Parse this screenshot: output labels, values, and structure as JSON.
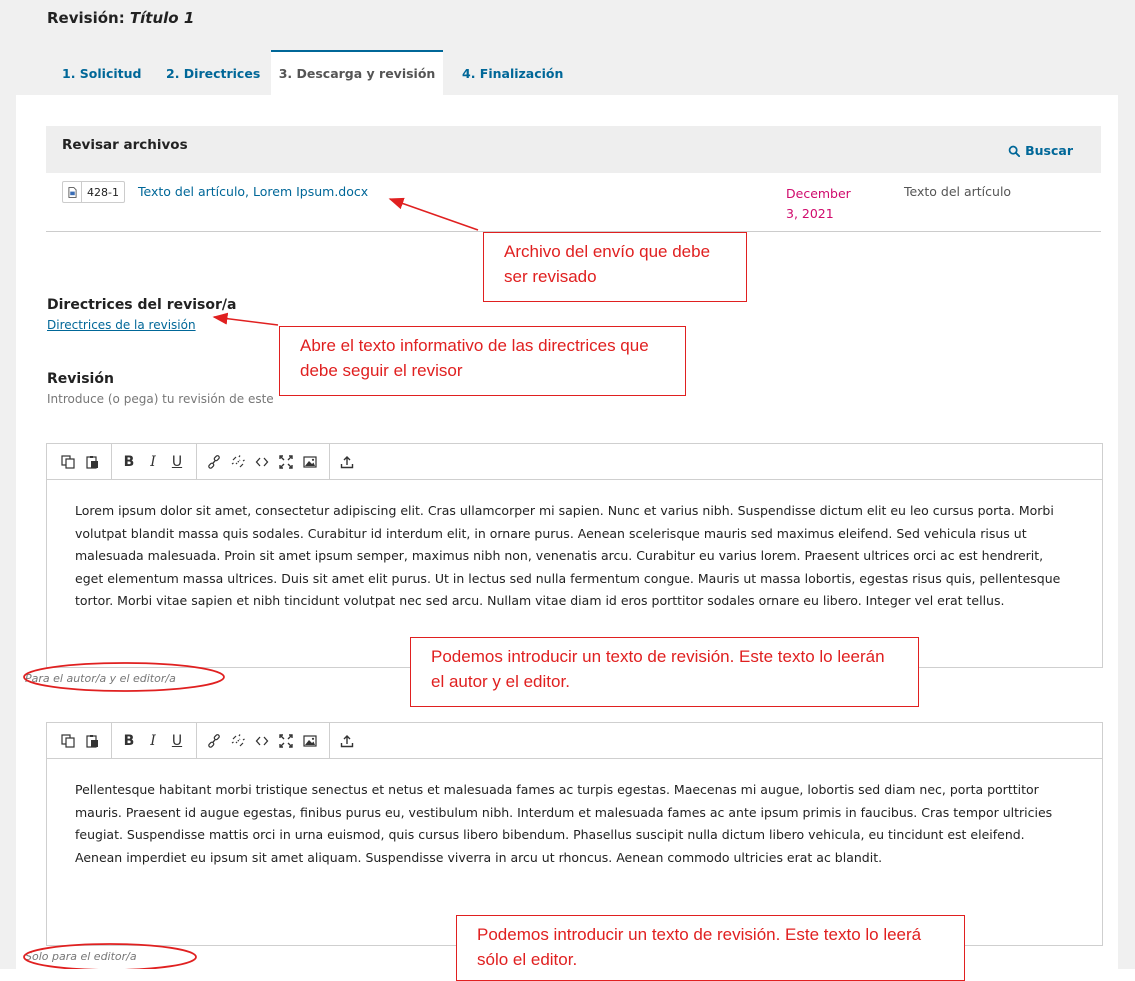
{
  "page": {
    "title_prefix": "Revisión: ",
    "title_name": "Título 1"
  },
  "tabs": [
    {
      "label": "1. Solicitud"
    },
    {
      "label": "2. Directrices"
    },
    {
      "label": "3. Descarga y revisión"
    },
    {
      "label": "4. Finalización"
    }
  ],
  "files": {
    "title": "Revisar archivos",
    "search_label": "Buscar",
    "row": {
      "id": "428-1",
      "name": "Texto del artículo, Lorem Ipsum.docx",
      "date": "December 3, 2021",
      "type": "Texto del artículo"
    }
  },
  "guidelines": {
    "heading": "Directrices del revisor/a",
    "link": "Directrices de la revisión"
  },
  "review": {
    "heading": "Revisión",
    "description": "Introduce (o pega) tu revisión de este"
  },
  "editor1": {
    "text": "Lorem ipsum dolor sit amet, consectetur adipiscing elit. Cras ullamcorper mi sapien. Nunc et varius nibh. Suspendisse dictum elit eu leo cursus porta. Morbi volutpat blandit massa quis sodales. Curabitur id interdum elit, in ornare purus. Aenean scelerisque mauris sed maximus eleifend. Sed vehicula risus ut malesuada malesuada. Proin sit amet ipsum semper, maximus nibh non, venenatis arcu. Curabitur eu varius lorem. Praesent ultrices orci ac est hendrerit, eget elementum massa ultrices. Duis sit amet elit purus. Ut in lectus sed nulla fermentum congue. Mauris ut massa lobortis, egestas risus quis, pellentesque tortor. Morbi vitae sapien et nibh tincidunt volutpat nec sed arcu. Nullam vitae diam id eros porttitor sodales ornare eu libero. Integer vel erat tellus.",
    "label": "Para el autor/a y el editor/a"
  },
  "editor2": {
    "text": "Pellentesque habitant morbi tristique senectus et netus et malesuada fames ac turpis egestas. Maecenas mi augue, lobortis sed diam nec, porta porttitor mauris. Praesent id augue egestas, finibus purus eu, vestibulum nibh. Interdum et malesuada fames ac ante ipsum primis in faucibus. Cras tempor ultricies feugiat. Suspendisse mattis orci in urna euismod, quis cursus libero bibendum. Phasellus suscipit nulla dictum libero vehicula, eu tincidunt est eleifend. Aenean imperdiet eu ipsum sit amet aliquam. Suspendisse viverra in arcu ut rhoncus. Aenean commodo ultricies erat ac blandit.",
    "label": "Solo para el editor/a"
  },
  "toolbar": {
    "bold": "B",
    "italic": "I",
    "underline": "U"
  },
  "callouts": {
    "file": "Archivo del envío que debe ser revisado",
    "guidelines": "Abre el texto informativo de las directrices que debe seguir el revisor",
    "author_editor": "Podemos introducir un texto de revisión. Este texto lo leerán el autor y el editor.",
    "editor_only": "Podemos introducir un texto de revisión. Este texto lo leerá sólo el editor."
  },
  "colors": {
    "link": "#006798",
    "date": "#d00a6c",
    "annotation": "#e02020"
  },
  "icons": [
    "search-icon",
    "doc-icon",
    "copy-icon",
    "paste-icon",
    "link-icon",
    "unlink-icon",
    "code-icon",
    "fullscreen-icon",
    "image-icon",
    "upload-icon"
  ]
}
